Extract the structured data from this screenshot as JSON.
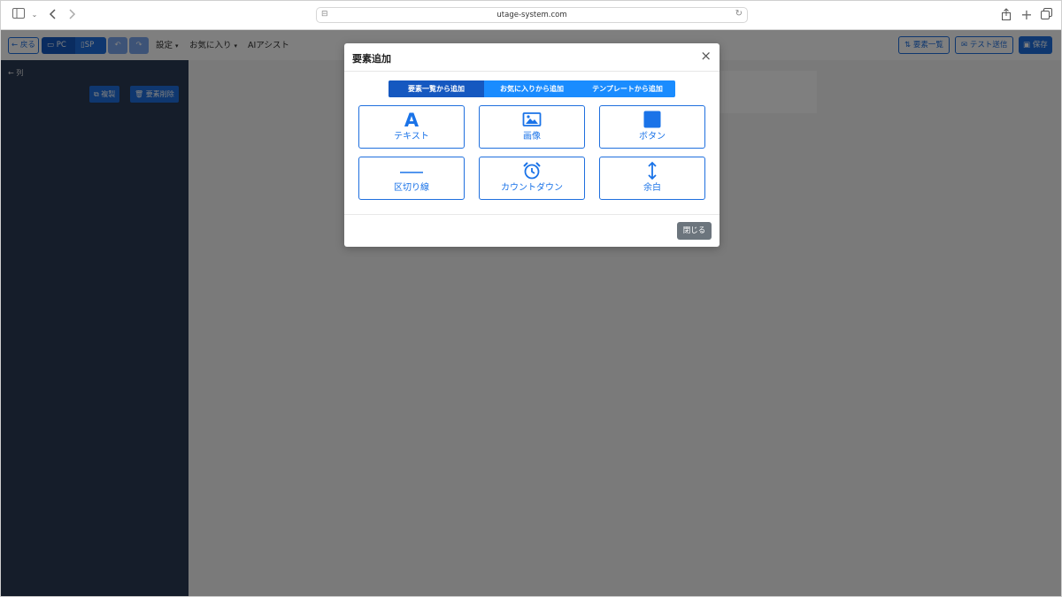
{
  "browser": {
    "url": "utage-system.com"
  },
  "toolbar": {
    "back_label": "← 戻る",
    "pc_label": "PC",
    "sp_label": "SP",
    "settings_label": "設定",
    "favorites_label": "お気に入り",
    "ai_assist_label": "AIアシスト",
    "element_list_label": "要素一覧",
    "test_send_label": "テスト送信",
    "save_label": "保存"
  },
  "sidebar": {
    "back_label": "← 列",
    "duplicate_label": "複製",
    "delete_label": "要素削除"
  },
  "modal": {
    "title": "要素追加",
    "close_icon": "×",
    "tabs": [
      {
        "label": "要素一覧から追加",
        "active": true
      },
      {
        "label": "お気に入りから追加",
        "active": false
      },
      {
        "label": "テンプレートから追加",
        "active": false
      }
    ],
    "tiles": [
      {
        "label": "テキスト",
        "icon": "text-a-icon"
      },
      {
        "label": "画像",
        "icon": "image-icon"
      },
      {
        "label": "ボタン",
        "icon": "button-square-icon"
      },
      {
        "label": "区切り線",
        "icon": "divider-line-icon"
      },
      {
        "label": "カウントダウン",
        "icon": "alarm-clock-icon"
      },
      {
        "label": "余白",
        "icon": "vertical-arrows-icon"
      }
    ],
    "close_button_label": "閉じる"
  },
  "colors": {
    "primary": "#1f6fde",
    "tab_active": "#1558c0",
    "tab_bg": "#1a8cff",
    "sidebar_bg": "#2b3a55",
    "close_button": "#6c757d"
  }
}
